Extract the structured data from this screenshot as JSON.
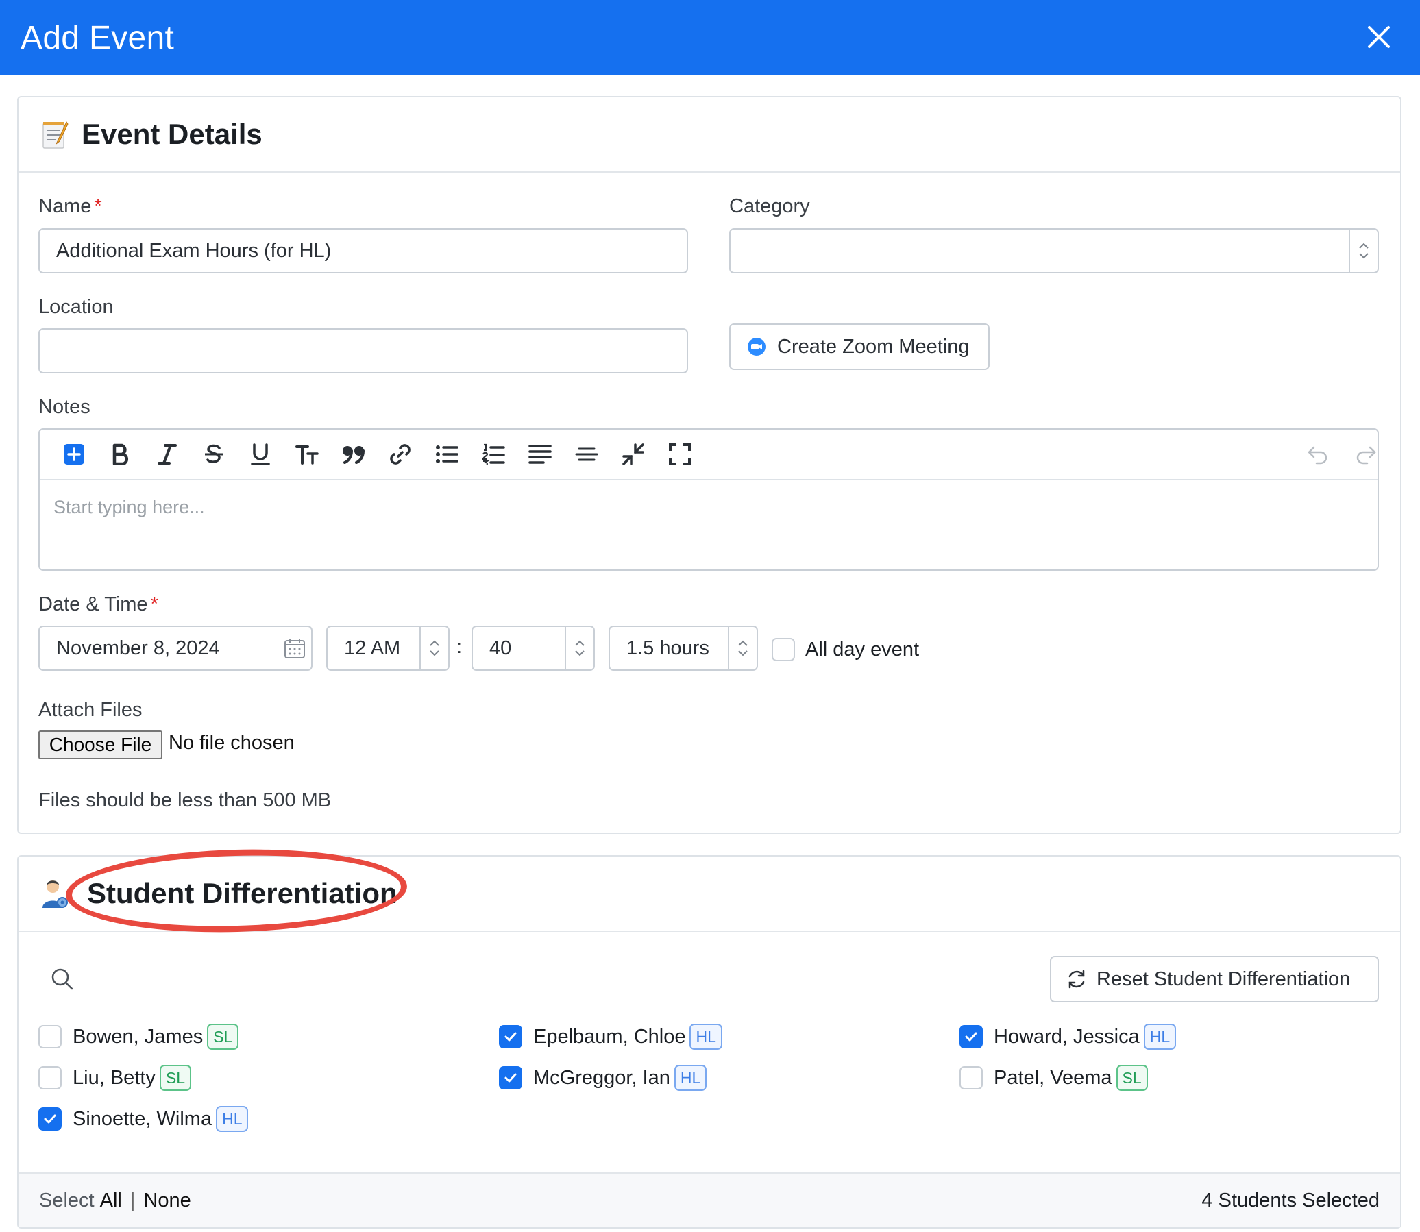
{
  "modal": {
    "title": "Add Event"
  },
  "colors": {
    "header_bg": "#1570ef",
    "accent": "#1570ef",
    "annotation": "#e8493f",
    "required": "#e02424"
  },
  "event_details": {
    "title": "Event Details",
    "icon": "memo-icon",
    "name_label": "Name",
    "required_mark": "*",
    "name_value": "Additional Exam Hours (for HL)",
    "category_label": "Category",
    "category_value": "",
    "location_label": "Location",
    "location_value": "",
    "zoom_button": "Create Zoom Meeting",
    "notes_label": "Notes",
    "notes_placeholder": "Start typing here...",
    "toolbar_icons": [
      "add-block-icon",
      "bold-icon",
      "italic-icon",
      "strikethrough-icon",
      "underline-icon",
      "text-size-icon",
      "quote-icon",
      "link-icon",
      "bullet-list-icon",
      "numbered-list-icon",
      "align-icon",
      "horizontal-rule-icon",
      "clear-format-icon",
      "fullscreen-icon",
      "undo-icon",
      "redo-icon"
    ],
    "datetime_label": "Date & Time",
    "date_value": "November 8, 2024",
    "hour_value": "12 AM",
    "time_sep": ":",
    "minute_value": "40",
    "duration_value": "1.5 hours",
    "all_day_label": "All day event",
    "all_day_checked": false,
    "attach_label": "Attach Files",
    "choose_file": "Choose File",
    "file_status": "No file chosen",
    "file_hint": "Files should be less than 500 MB"
  },
  "differentiation": {
    "title": "Student Differentiation",
    "icon": "student-icon",
    "reset_button": "Reset Student Differentiation",
    "students": [
      {
        "name": "Bowen, James",
        "level": "SL",
        "checked": false
      },
      {
        "name": "Epelbaum, Chloe",
        "level": "HL",
        "checked": true
      },
      {
        "name": "Howard, Jessica",
        "level": "HL",
        "checked": true
      },
      {
        "name": "Liu, Betty",
        "level": "SL",
        "checked": false
      },
      {
        "name": "McGreggor, Ian",
        "level": "HL",
        "checked": true
      },
      {
        "name": "Patel, Veema",
        "level": "SL",
        "checked": false
      },
      {
        "name": "Sinoette, Wilma",
        "level": "HL",
        "checked": true
      }
    ],
    "select_label": "Select",
    "select_all": "All",
    "select_sep": "|",
    "select_none": "None",
    "selected_count": "4 Students Selected"
  }
}
